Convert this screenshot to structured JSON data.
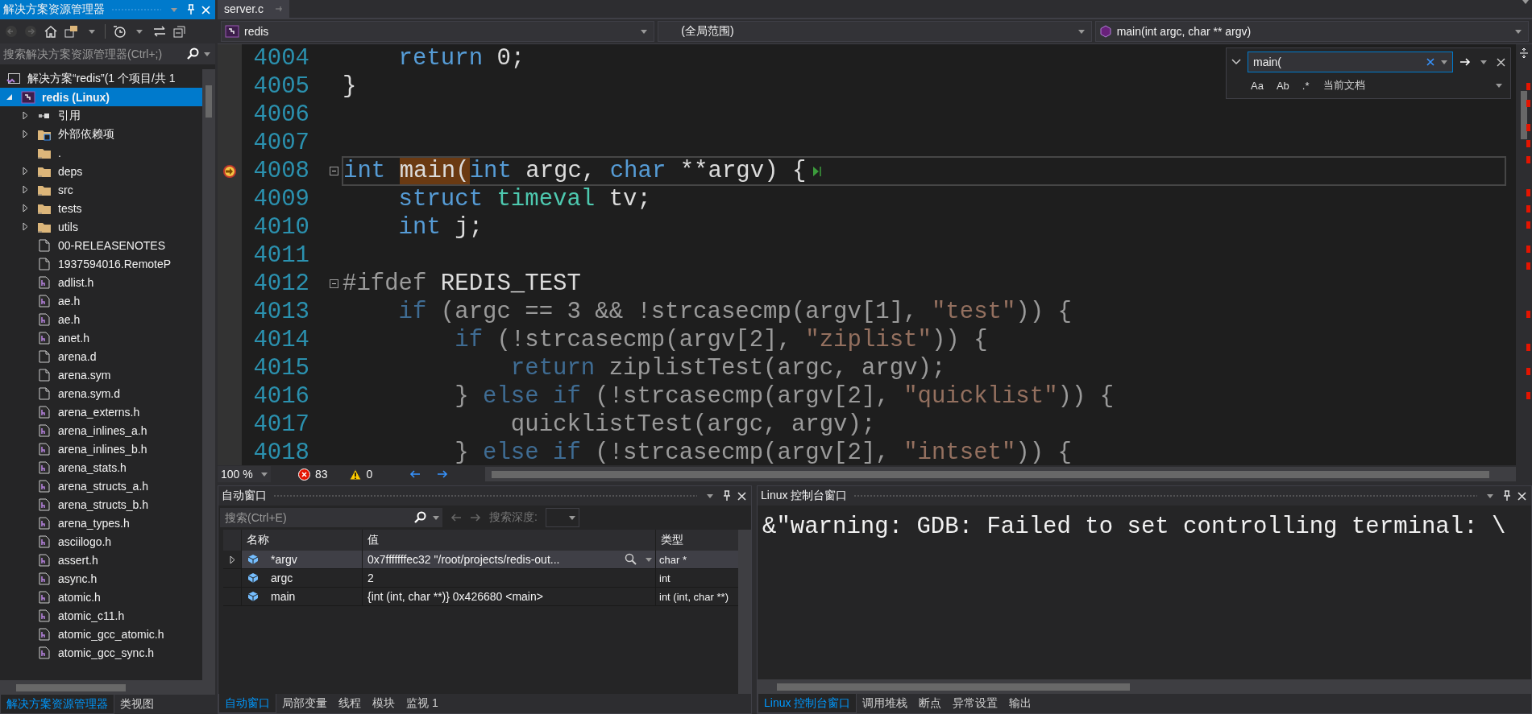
{
  "explorer": {
    "title": "解决方案资源管理器",
    "search": {
      "placeholder": "搜索解决方案资源管理器(Ctrl+;)"
    },
    "tree": [
      {
        "kind": "solution",
        "label": "解决方案“redis”(1 个项目/共 1",
        "selected": false,
        "children": [
          {
            "kind": "project",
            "label": "redis (Linux)",
            "selected": true,
            "expanded": true,
            "children": [
              {
                "kind": "references",
                "label": "引用",
                "selected": false,
                "expanded": false
              },
              {
                "kind": "external",
                "label": "外部依赖项",
                "selected": false,
                "expanded": false
              },
              {
                "kind": "folder",
                "label": ".",
                "selected": false
              },
              {
                "kind": "folder",
                "label": "deps",
                "selected": false,
                "expanded": false
              },
              {
                "kind": "folder",
                "label": "src",
                "selected": false,
                "expanded": false
              },
              {
                "kind": "folder",
                "label": "tests",
                "selected": false,
                "expanded": false
              },
              {
                "kind": "folder",
                "label": "utils",
                "selected": false,
                "expanded": false
              },
              {
                "kind": "file",
                "label": "00-RELEASENOTES",
                "selected": false
              },
              {
                "kind": "file",
                "label": "1937594016.RemoteP",
                "selected": false
              },
              {
                "kind": "header",
                "label": "adlist.h",
                "selected": false
              },
              {
                "kind": "header",
                "label": "ae.h",
                "selected": false
              },
              {
                "kind": "header",
                "label": "ae.h",
                "selected": false
              },
              {
                "kind": "header",
                "label": "anet.h",
                "selected": false
              },
              {
                "kind": "file",
                "label": "arena.d",
                "selected": false
              },
              {
                "kind": "file",
                "label": "arena.sym",
                "selected": false
              },
              {
                "kind": "file",
                "label": "arena.sym.d",
                "selected": false
              },
              {
                "kind": "header",
                "label": "arena_externs.h",
                "selected": false
              },
              {
                "kind": "header",
                "label": "arena_inlines_a.h",
                "selected": false
              },
              {
                "kind": "header",
                "label": "arena_inlines_b.h",
                "selected": false
              },
              {
                "kind": "header",
                "label": "arena_stats.h",
                "selected": false
              },
              {
                "kind": "header",
                "label": "arena_structs_a.h",
                "selected": false
              },
              {
                "kind": "header",
                "label": "arena_structs_b.h",
                "selected": false
              },
              {
                "kind": "header",
                "label": "arena_types.h",
                "selected": false
              },
              {
                "kind": "header",
                "label": "asciilogo.h",
                "selected": false
              },
              {
                "kind": "header",
                "label": "assert.h",
                "selected": false
              },
              {
                "kind": "header",
                "label": "async.h",
                "selected": false
              },
              {
                "kind": "header",
                "label": "atomic.h",
                "selected": false
              },
              {
                "kind": "header",
                "label": "atomic_c11.h",
                "selected": false
              },
              {
                "kind": "header",
                "label": "atomic_gcc_atomic.h",
                "selected": false
              },
              {
                "kind": "header",
                "label": "atomic_gcc_sync.h",
                "selected": false
              }
            ]
          }
        ]
      }
    ],
    "tabs": [
      {
        "label": "解决方案资源管理器",
        "selected": true
      },
      {
        "label": "类视图",
        "selected": false
      }
    ]
  },
  "editor": {
    "tabs": [
      {
        "label": "server.c",
        "selected": true
      }
    ],
    "nav": [
      {
        "kind": "project",
        "label": "redis"
      },
      {
        "kind": "scope",
        "label": "(全局范围)"
      },
      {
        "kind": "method",
        "label": "main(int argc, char ** argv)"
      }
    ],
    "find": {
      "value": "main(",
      "scope": "当前文档",
      "options": [
        {
          "label": "Aa",
          "selected": false
        },
        {
          "label": "Ab",
          "selected": false
        },
        {
          "label": ".*",
          "selected": false
        }
      ]
    },
    "lines": [
      {
        "number": "4004",
        "fold": false,
        "current": false,
        "inactive": false,
        "tokens": [
          {
            "kind": "keyword",
            "text": "    return"
          },
          {
            "kind": "plain",
            "text": " 0;"
          }
        ]
      },
      {
        "number": "4005",
        "fold": false,
        "current": false,
        "inactive": false,
        "tokens": [
          {
            "kind": "plain",
            "text": "}"
          }
        ]
      },
      {
        "number": "4006",
        "fold": false,
        "current": false
      },
      {
        "number": "4007",
        "fold": false,
        "current": false
      },
      {
        "number": "4008",
        "fold": true,
        "current": true,
        "inactive": false,
        "tokens": [
          {
            "kind": "keyword",
            "text": "int "
          },
          {
            "kind": "match",
            "text": "main("
          },
          {
            "kind": "keyword",
            "text": "int"
          },
          {
            "kind": "plain",
            "text": " argc, "
          },
          {
            "kind": "keyword",
            "text": "char"
          },
          {
            "kind": "plain",
            "text": " **argv) {"
          }
        ]
      },
      {
        "number": "4009",
        "fold": false,
        "current": false,
        "inactive": false,
        "tokens": [
          {
            "kind": "keyword",
            "text": "    struct "
          },
          {
            "kind": "type",
            "text": "timeval"
          },
          {
            "kind": "plain",
            "text": " tv;"
          }
        ]
      },
      {
        "number": "4010",
        "fold": false,
        "current": false,
        "inactive": false,
        "tokens": [
          {
            "kind": "keyword",
            "text": "    int"
          },
          {
            "kind": "plain",
            "text": " j;"
          }
        ]
      },
      {
        "number": "4011",
        "fold": false,
        "current": false
      },
      {
        "number": "4012",
        "fold": true,
        "current": false,
        "inactive": false,
        "tokens": [
          {
            "kind": "preproc",
            "text": "#ifdef"
          },
          {
            "kind": "plain",
            "text": " REDIS_TEST"
          }
        ]
      },
      {
        "number": "4013",
        "fold": false,
        "current": false,
        "inactive": true,
        "tokens": [
          {
            "kind": "keyword",
            "text": "    if"
          },
          {
            "kind": "plain",
            "text": " (argc == 3 && !strcasecmp(argv[1], "
          },
          {
            "kind": "string",
            "text": "\"test\""
          },
          {
            "kind": "plain",
            "text": ")) {"
          }
        ]
      },
      {
        "number": "4014",
        "fold": false,
        "current": false,
        "inactive": true,
        "tokens": [
          {
            "kind": "keyword",
            "text": "        if"
          },
          {
            "kind": "plain",
            "text": " (!strcasecmp(argv[2], "
          },
          {
            "kind": "string",
            "text": "\"ziplist\""
          },
          {
            "kind": "plain",
            "text": ")) {"
          }
        ]
      },
      {
        "number": "4015",
        "fold": false,
        "current": false,
        "inactive": true,
        "tokens": [
          {
            "kind": "keyword",
            "text": "            return"
          },
          {
            "kind": "plain",
            "text": " ziplistTest(argc, argv);"
          }
        ]
      },
      {
        "number": "4016",
        "fold": false,
        "current": false,
        "inactive": true,
        "tokens": [
          {
            "kind": "plain",
            "text": "        } "
          },
          {
            "kind": "keyword",
            "text": "else if"
          },
          {
            "kind": "plain",
            "text": " (!strcasecmp(argv[2], "
          },
          {
            "kind": "string",
            "text": "\"quicklist\""
          },
          {
            "kind": "plain",
            "text": ")) {"
          }
        ]
      },
      {
        "number": "4017",
        "fold": false,
        "current": false,
        "inactive": true,
        "tokens": [
          {
            "kind": "plain",
            "text": "            quicklistTest(argc, argv);"
          }
        ]
      },
      {
        "number": "4018",
        "fold": false,
        "current": false,
        "inactive": true,
        "tokens": [
          {
            "kind": "plain",
            "text": "        } "
          },
          {
            "kind": "keyword",
            "text": "else if"
          },
          {
            "kind": "plain",
            "text": " (!strcasecmp(argv[2], "
          },
          {
            "kind": "string",
            "text": "\"intset\""
          },
          {
            "kind": "plain",
            "text": ")) {"
          }
        ]
      }
    ],
    "status": {
      "zoom": "100 %",
      "errors": "83",
      "warnings": "0"
    }
  },
  "autos": {
    "title": "自动窗口",
    "search": {
      "placeholder": "搜索(Ctrl+E)"
    },
    "depth_label": "搜索深度:",
    "columns": [
      "名称",
      "值",
      "类型"
    ],
    "rows": [
      {
        "name": "*argv",
        "value": "0x7fffffffec32 \"/root/projects/redis-out...",
        "type": "char *",
        "expanded": false,
        "selected": true
      },
      {
        "name": "argc",
        "value": "2",
        "type": "int",
        "selected": false
      },
      {
        "name": "main",
        "value": "{int (int, char **)} 0x426680 <main>",
        "type": "int (int, char **)",
        "selected": false
      }
    ],
    "tabs": [
      {
        "label": "自动窗口",
        "selected": true
      },
      {
        "label": "局部变量",
        "selected": false
      },
      {
        "label": "线程",
        "selected": false
      },
      {
        "label": "模块",
        "selected": false
      },
      {
        "label": "监视 1",
        "selected": false
      }
    ]
  },
  "console": {
    "title": "Linux 控制台窗口",
    "lines": [
      "&\"warning: GDB: Failed to set controlling terminal: \\"
    ],
    "tabs": [
      {
        "label": "Linux 控制台窗口",
        "selected": true
      },
      {
        "label": "调用堆栈",
        "selected": false
      },
      {
        "label": "断点",
        "selected": false
      },
      {
        "label": "异常设置",
        "selected": false
      },
      {
        "label": "输出",
        "selected": false
      }
    ]
  }
}
